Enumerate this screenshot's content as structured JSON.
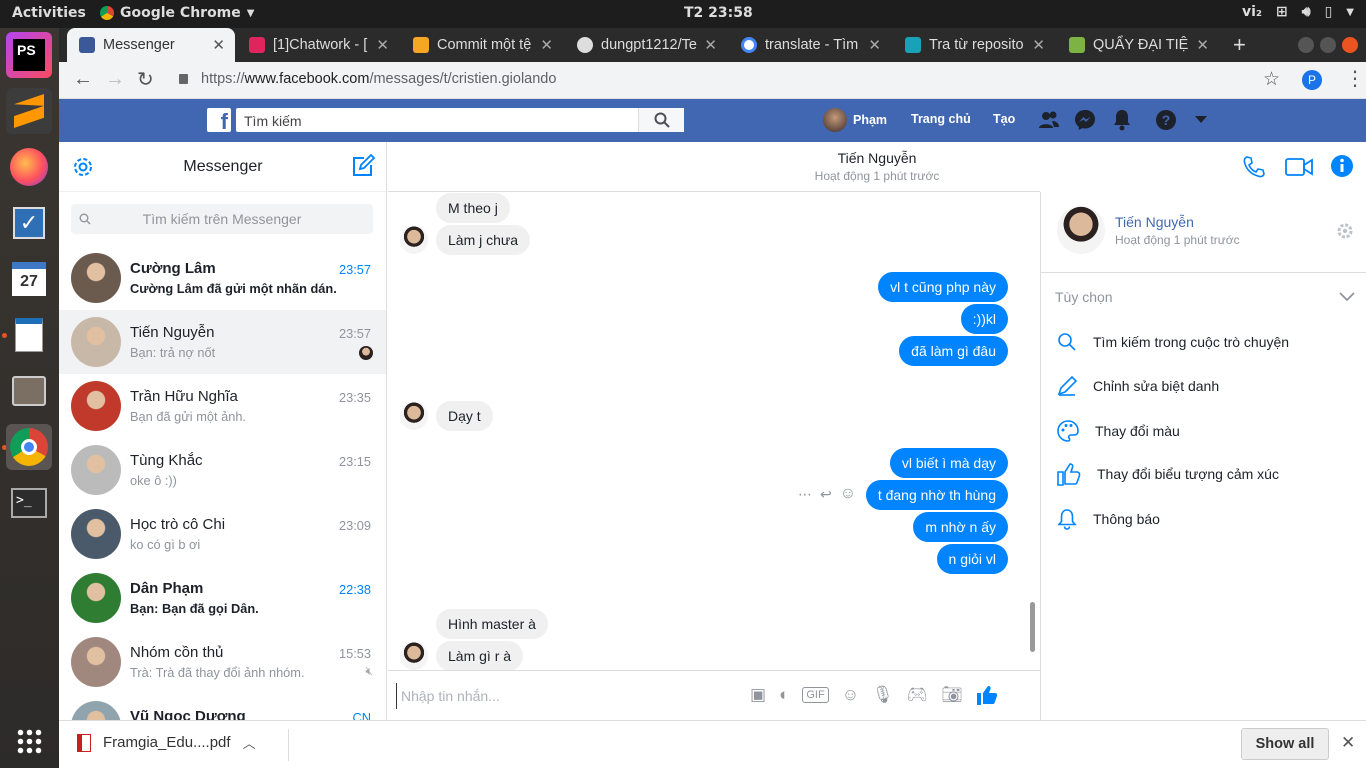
{
  "topbar": {
    "activities": "Activities",
    "app_name": "Google Chrome",
    "clock": "T2 23:58",
    "lang": "vi₂"
  },
  "dock": {
    "calendar_day": "27",
    "ps_label": "PS"
  },
  "tabs": [
    {
      "label": "Messenger",
      "color": "#3b5998"
    },
    {
      "label": "[1]Chatwork - [",
      "color": "#e0245e"
    },
    {
      "label": "Commit một tệ",
      "color": "#f5a623"
    },
    {
      "label": "dungpt1212/Te",
      "color": "#222222"
    },
    {
      "label": "translate - Tìm",
      "color": "#4285f4"
    },
    {
      "label": "Tra từ reposito",
      "color": "#17a2b8"
    },
    {
      "label": "QUẨY ĐẠI TIỆ",
      "color": "#7cb342"
    }
  ],
  "address": {
    "scheme": "https://",
    "host": "www.facebook.com",
    "path": "/messages/t/cristien.giolando"
  },
  "profile_initial": "P",
  "fb": {
    "search_placeholder": "Tìm kiếm",
    "user": "Phạm",
    "home": "Trang chủ",
    "create": "Tạo"
  },
  "messenger": {
    "title": "Messenger",
    "search_placeholder": "Tìm kiếm trên Messenger",
    "conversations": [
      {
        "name": "Cường Lâm",
        "preview": "Cường Lâm đã gửi một nhãn dán.",
        "time": "23:57",
        "unread": true,
        "avatar_color": "#6b5a4e"
      },
      {
        "name": "Tiến Nguyễn",
        "preview": "Bạn: trả nợ nốt",
        "time": "23:57",
        "unread": false,
        "avatar_color": "#c8b8a8"
      },
      {
        "name": "Trần Hữu Nghĩa",
        "preview": "Bạn đã gửi một ảnh.",
        "time": "23:35",
        "unread": false,
        "avatar_color": "#c0392b"
      },
      {
        "name": "Tùng Khắc",
        "preview": "oke ô :))",
        "time": "23:15",
        "unread": false,
        "avatar_color": "#bbbbbb"
      },
      {
        "name": "Học trò cô Chi",
        "preview": "ko có gì b ơi",
        "time": "23:09",
        "unread": false,
        "avatar_color": "#4a5a6a"
      },
      {
        "name": "Dân Phạm",
        "preview": "Bạn: Bạn đã gọi Dân.",
        "time": "22:38",
        "unread": true,
        "avatar_color": "#2e7d32"
      },
      {
        "name": "Nhóm cồn thủ",
        "preview": "Trà: Trà đã thay đổi ảnh nhóm.",
        "time": "15:53",
        "unread": false,
        "avatar_color": "#a1887f"
      },
      {
        "name": "Vũ Ngọc Dương",
        "preview": "",
        "time": "CN",
        "unread": true,
        "avatar_color": "#90a4ae"
      }
    ]
  },
  "chat": {
    "name": "Tiến Nguyễn",
    "status": "Hoạt động 1 phút trước",
    "messages": [
      {
        "text": "M theo j",
        "dir": "in"
      },
      {
        "text": "Làm j chưa",
        "dir": "in"
      },
      {
        "text": "vl t cũng php này",
        "dir": "out"
      },
      {
        "text": ":))kl",
        "dir": "out"
      },
      {
        "text": "đã làm gì đâu",
        "dir": "out"
      },
      {
        "text": "Dạy t",
        "dir": "in"
      },
      {
        "text": "vl biết ì mà dạy",
        "dir": "out"
      },
      {
        "text": "t đang nhờ th hùng",
        "dir": "out"
      },
      {
        "text": "m nhờ n ấy",
        "dir": "out"
      },
      {
        "text": "n giỏi vl",
        "dir": "out"
      },
      {
        "text": "Hình master à",
        "dir": "in"
      },
      {
        "text": "Làm gì r à",
        "dir": "in"
      }
    ],
    "composer_placeholder": "Nhập tin nhắn..."
  },
  "details": {
    "name": "Tiến Nguyễn",
    "status": "Hoạt động 1 phút trước",
    "options_header": "Tùy chọn",
    "options": [
      {
        "label": "Tìm kiếm trong cuộc trò chuyện",
        "icon": "search-icon"
      },
      {
        "label": "Chỉnh sửa biệt danh",
        "icon": "pencil-icon"
      },
      {
        "label": "Thay đổi màu",
        "icon": "palette-icon"
      },
      {
        "label": "Thay đổi biểu tượng cảm xúc",
        "icon": "thumbs-up-icon"
      },
      {
        "label": "Thông báo",
        "icon": "bell-icon"
      }
    ]
  },
  "download": {
    "file": "Framgia_Edu....pdf",
    "show_all": "Show all"
  },
  "colors": {
    "fb_blue": "#4267b2",
    "messenger_blue": "#0084ff",
    "ubuntu_orange": "#e95420"
  }
}
